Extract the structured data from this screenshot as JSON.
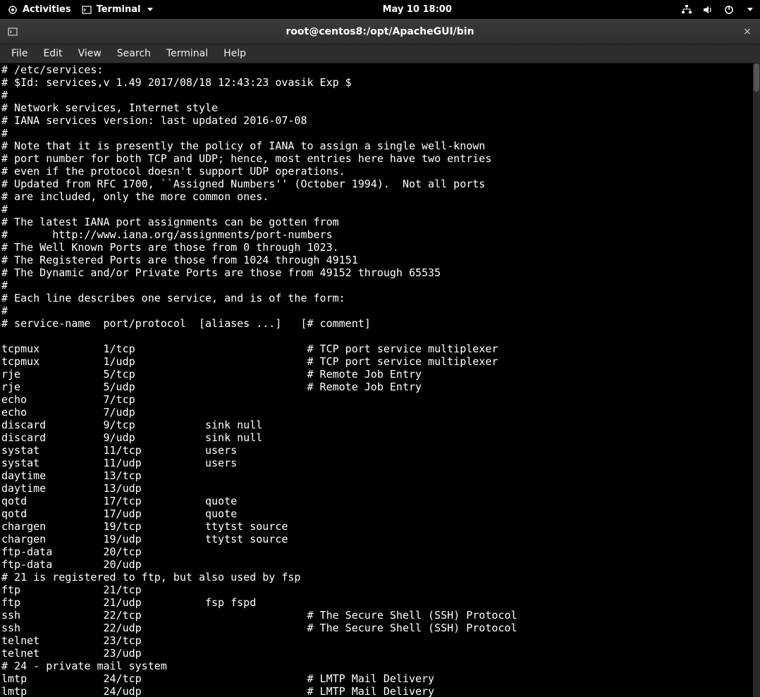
{
  "topbar": {
    "activities": "Activities",
    "app_name": "Terminal",
    "datetime": "May 10  18:00"
  },
  "window": {
    "title": "root@centos8:/opt/ApacheGUI/bin",
    "close_label": "×"
  },
  "menubar": {
    "items": [
      "File",
      "Edit",
      "View",
      "Search",
      "Terminal",
      "Help"
    ]
  },
  "terminal": {
    "content": "# /etc/services:\n# $Id: services,v 1.49 2017/08/18 12:43:23 ovasik Exp $\n#\n# Network services, Internet style\n# IANA services version: last updated 2016-07-08\n#\n# Note that it is presently the policy of IANA to assign a single well-known\n# port number for both TCP and UDP; hence, most entries here have two entries\n# even if the protocol doesn't support UDP operations.\n# Updated from RFC 1700, ``Assigned Numbers'' (October 1994).  Not all ports\n# are included, only the more common ones.\n#\n# The latest IANA port assignments can be gotten from\n#       http://www.iana.org/assignments/port-numbers\n# The Well Known Ports are those from 0 through 1023.\n# The Registered Ports are those from 1024 through 49151\n# The Dynamic and/or Private Ports are those from 49152 through 65535\n#\n# Each line describes one service, and is of the form:\n#\n# service-name  port/protocol  [aliases ...]   [# comment]\n\ntcpmux          1/tcp                           # TCP port service multiplexer\ntcpmux          1/udp                           # TCP port service multiplexer\nrje             5/tcp                           # Remote Job Entry\nrje             5/udp                           # Remote Job Entry\necho            7/tcp\necho            7/udp\ndiscard         9/tcp           sink null\ndiscard         9/udp           sink null\nsystat          11/tcp          users\nsystat          11/udp          users\ndaytime         13/tcp\ndaytime         13/udp\nqotd            17/tcp          quote\nqotd            17/udp          quote\nchargen         19/tcp          ttytst source\nchargen         19/udp          ttytst source\nftp-data        20/tcp\nftp-data        20/udp\n# 21 is registered to ftp, but also used by fsp\nftp             21/tcp\nftp             21/udp          fsp fspd\nssh             22/tcp                          # The Secure Shell (SSH) Protocol\nssh             22/udp                          # The Secure Shell (SSH) Protocol\ntelnet          23/tcp\ntelnet          23/udp\n# 24 - private mail system\nlmtp            24/tcp                          # LMTP Mail Delivery\nlmtp            24/udp                          # LMTP Mail Delivery"
  }
}
